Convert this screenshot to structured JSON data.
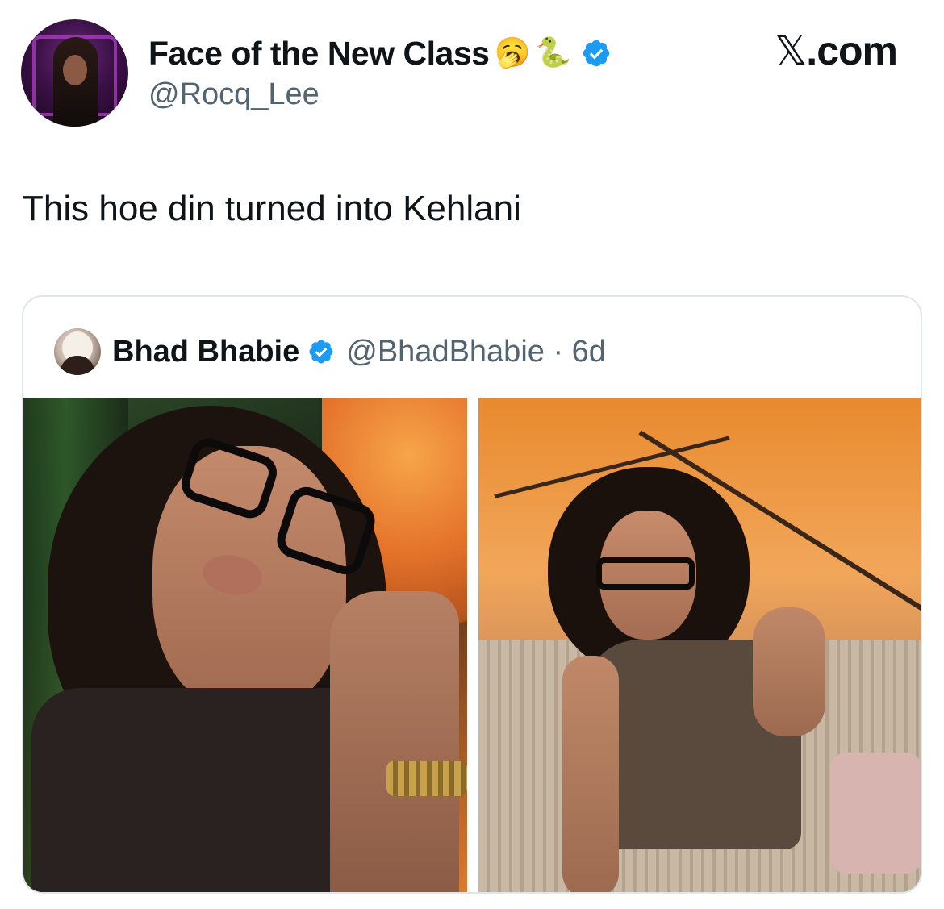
{
  "post": {
    "author_name": "Face of the New Class",
    "name_emojis": [
      "🥱",
      "🐍"
    ],
    "handle": "@Rocq_Lee",
    "text": "This hoe din turned into Kehlani"
  },
  "brand": {
    "x_glyph": "𝕏",
    "suffix": ".com"
  },
  "quoted_post": {
    "author_name": "Bhad Bhabie",
    "handle_and_time": "@BhadBhabie · 6d",
    "photo_count": 2
  },
  "colors": {
    "verified_blue": "#1d9bf0",
    "secondary_text": "#536471",
    "border": "#e1e6ea"
  }
}
